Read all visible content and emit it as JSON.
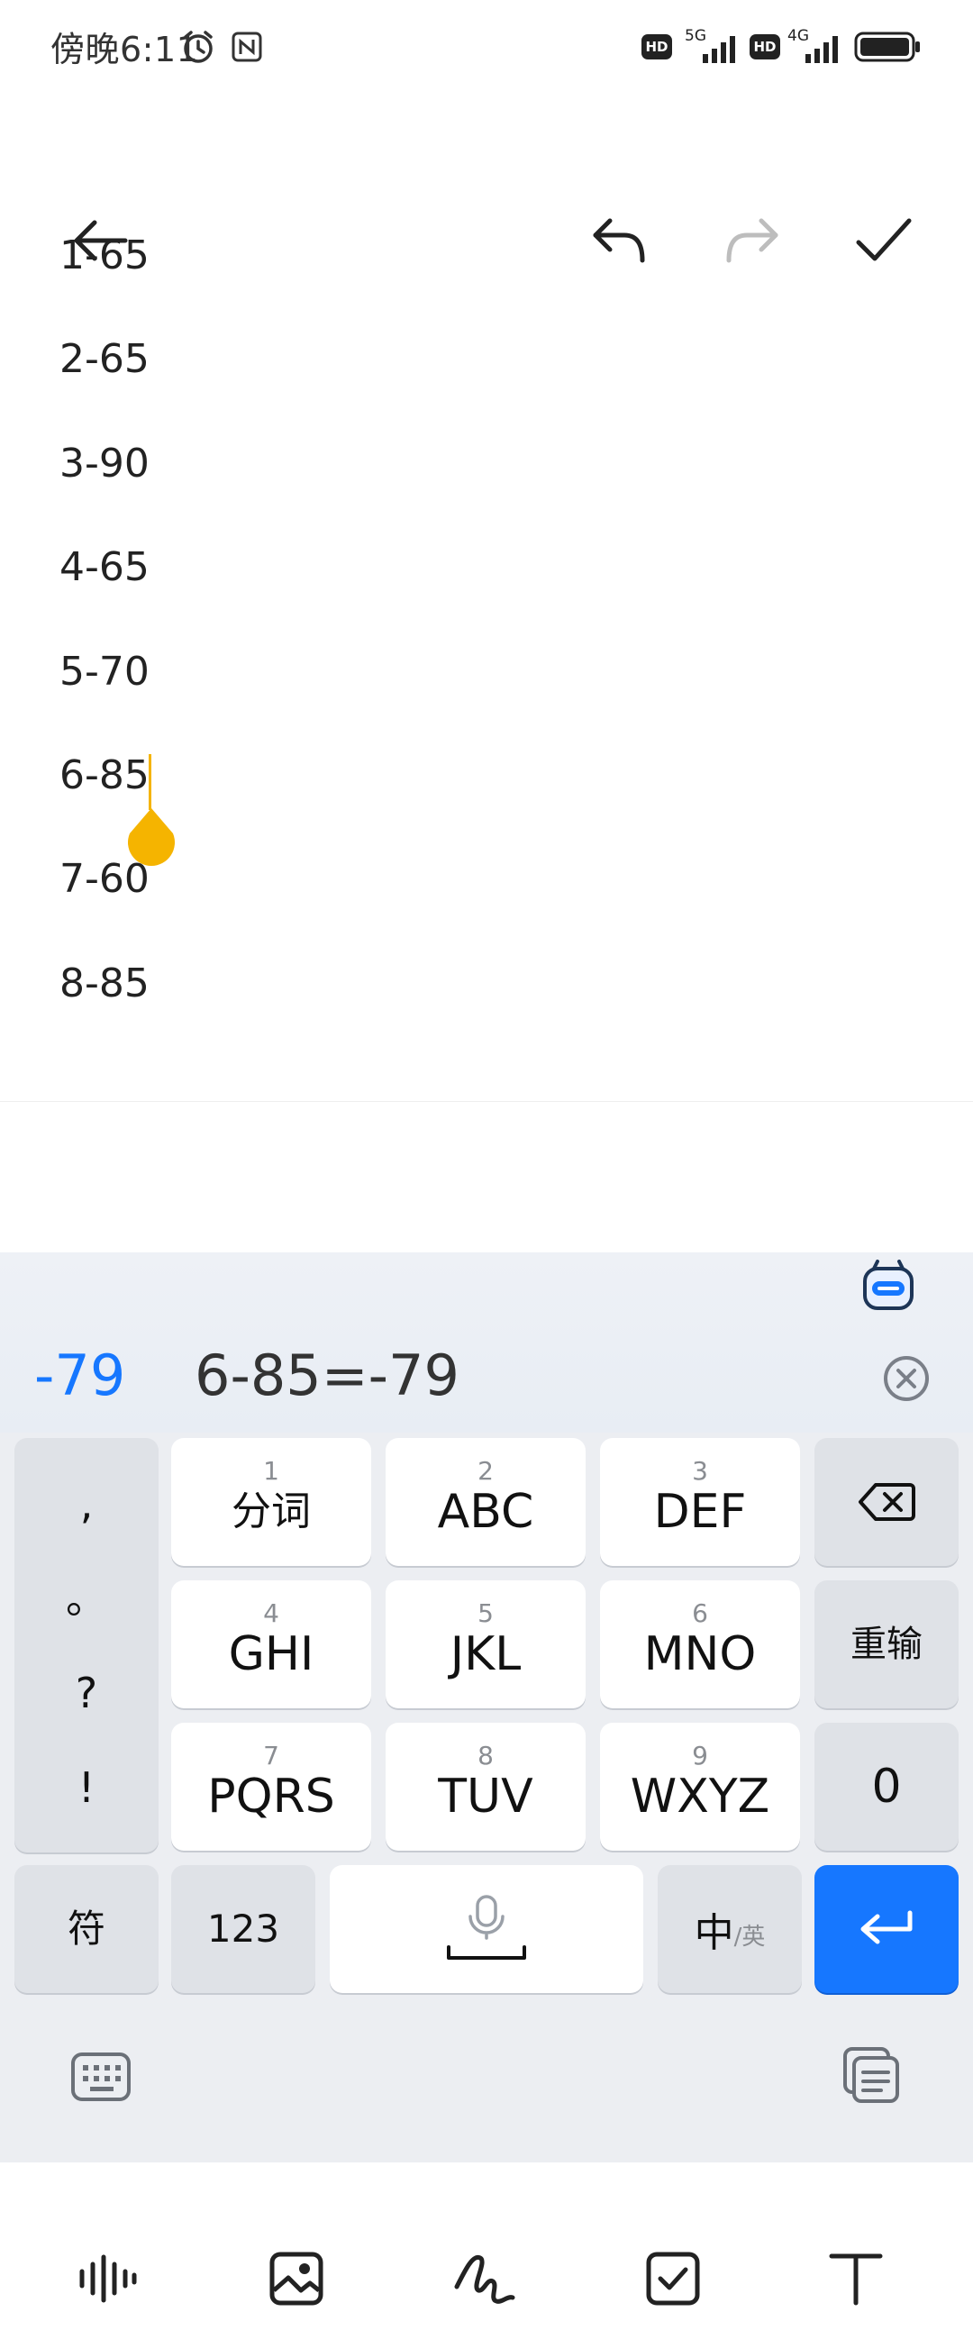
{
  "status_bar": {
    "time": "傍晚6:11",
    "network_1": "5G",
    "network_2": "4G",
    "hd_1": "HD",
    "hd_2": "HD"
  },
  "toolbar": {
    "back_icon": "arrow-left-icon",
    "undo_icon": "undo-icon",
    "redo_icon": "redo-icon",
    "done_icon": "check-icon"
  },
  "note": {
    "lines": [
      "1-65",
      "2-65",
      "3-90",
      "4-65",
      "5-70",
      "6-85",
      "7-60",
      "8-85"
    ],
    "cursor_color": "#f5b400"
  },
  "format_bar": {
    "items": [
      "voice-wave-icon",
      "image-icon",
      "handwriting-icon",
      "checkbox-icon",
      "text-format-icon"
    ]
  },
  "keyboard": {
    "candidate": "-79",
    "expression": "6-85=-79",
    "accent_color": "#1677ff",
    "punct": [
      ",",
      "。",
      "?",
      "!"
    ],
    "keys": [
      {
        "num": "1",
        "label": "分词"
      },
      {
        "num": "2",
        "label": "ABC"
      },
      {
        "num": "3",
        "label": "DEF"
      },
      {
        "num": "4",
        "label": "GHI"
      },
      {
        "num": "5",
        "label": "JKL"
      },
      {
        "num": "6",
        "label": "MNO"
      },
      {
        "num": "7",
        "label": "PQRS"
      },
      {
        "num": "8",
        "label": "TUV"
      },
      {
        "num": "9",
        "label": "WXYZ"
      }
    ],
    "reinput": "重输",
    "zero": "0",
    "symbols": "符",
    "numbers": "123",
    "lang_main": "中",
    "lang_sub": "/英"
  }
}
